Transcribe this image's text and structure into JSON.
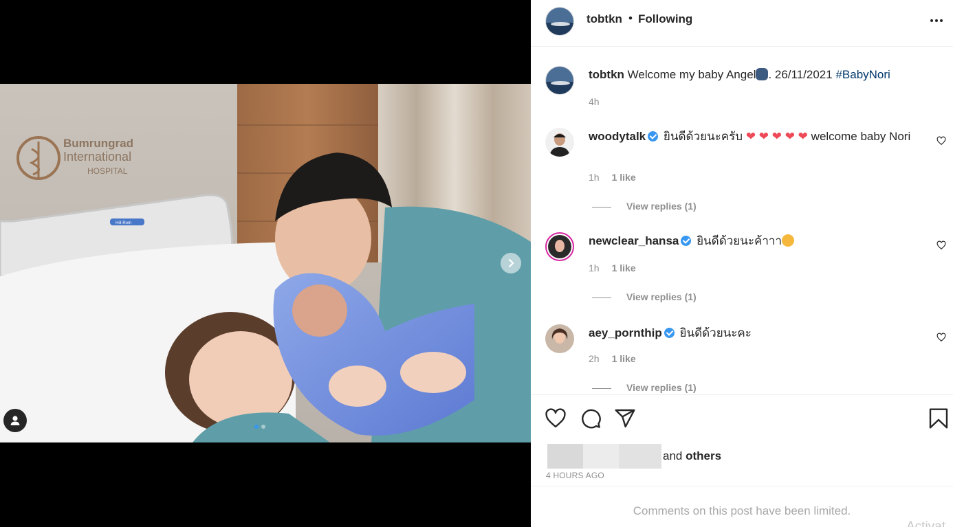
{
  "post": {
    "author": "tobtkn",
    "separator": "•",
    "follow_status": "Following",
    "caption_text": "Welcome my baby Angel",
    "caption_date": ". 26/11/2021 ",
    "caption_hashtag": "#BabyNori",
    "caption_time": "4h",
    "photo_sign": {
      "line1": "Bumrungrad",
      "line2": "International",
      "line3": "HOSPITAL",
      "bed_label": "Hill-Rom"
    },
    "carousel": {
      "current": 1,
      "total": 2
    }
  },
  "comments": [
    {
      "user": "woodytalk",
      "verified": true,
      "text": "ยินดีด้วยนะครับ",
      "text_after": " welcome baby Nori",
      "time": "1h",
      "likes": "1 like",
      "replies": "View replies (1)"
    },
    {
      "user": "newclear_hansa",
      "verified": true,
      "text": "ยินดีด้วยนะค้าาา",
      "time": "1h",
      "likes": "1 like",
      "replies": "View replies (1)"
    },
    {
      "user": "aey_pornthip",
      "verified": true,
      "text": "ยินดีด้วยนะคะ",
      "time": "2h",
      "likes": "1 like",
      "replies": "View replies (1)"
    }
  ],
  "likes_summary": {
    "and": "and",
    "others": "others"
  },
  "timestamp": "4 HOURS AGO",
  "limited_notice": "Comments on this post have been limited.",
  "watermark": "Activat",
  "colors": {
    "accent": "#3897f0",
    "hashtag": "#00376b",
    "muted": "#8e8e8e",
    "heart": "#ed4956"
  },
  "icons": [
    "more-icon",
    "heart-icon",
    "comment-icon",
    "share-icon",
    "bookmark-icon",
    "chevron-right-icon",
    "user-tag-icon",
    "verified-icon"
  ]
}
